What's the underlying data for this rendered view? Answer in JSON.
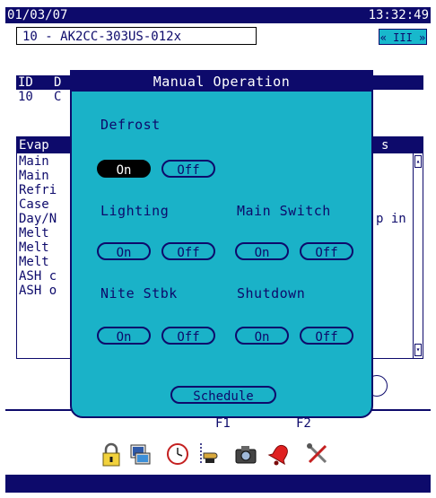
{
  "header": {
    "date": "01/03/07",
    "time": "13:32:49"
  },
  "device": {
    "name": "10 - AK2CC-303US-012x",
    "pager_label": "« III »"
  },
  "table": {
    "col_id": "ID",
    "col_d": "D",
    "row_id": "10",
    "row_c": "C"
  },
  "list": {
    "header_left": "Evap",
    "header_right": "s",
    "items": [
      "Main",
      "Main",
      "Refri",
      "Case",
      "Day/N",
      "Melt",
      "Melt",
      "Melt",
      "ASH c",
      "ASH o"
    ],
    "overflow_text": "p in"
  },
  "modal": {
    "title": "Manual Operation",
    "defrost": {
      "label": "Defrost",
      "on": "On",
      "off": "Off",
      "state": "on"
    },
    "lighting": {
      "label": "Lighting",
      "on": "On",
      "off": "Off"
    },
    "main_switch": {
      "label": "Main Switch",
      "on": "On",
      "off": "Off"
    },
    "nite_stbk": {
      "label": "Nite Stbk",
      "on": "On",
      "off": "Off"
    },
    "shutdown": {
      "label": "Shutdown",
      "on": "On",
      "off": "Off"
    },
    "schedule": "Schedule"
  },
  "footer": {
    "f1": "F1",
    "f2": "F2",
    "icons": [
      "lock-icon",
      "network-icon",
      "clock-icon",
      "pointer-icon",
      "camera-icon",
      "alarm-icon",
      "tools-icon"
    ]
  },
  "colors": {
    "navy": "#0d0a6b",
    "cyan": "#1ab2c8"
  }
}
